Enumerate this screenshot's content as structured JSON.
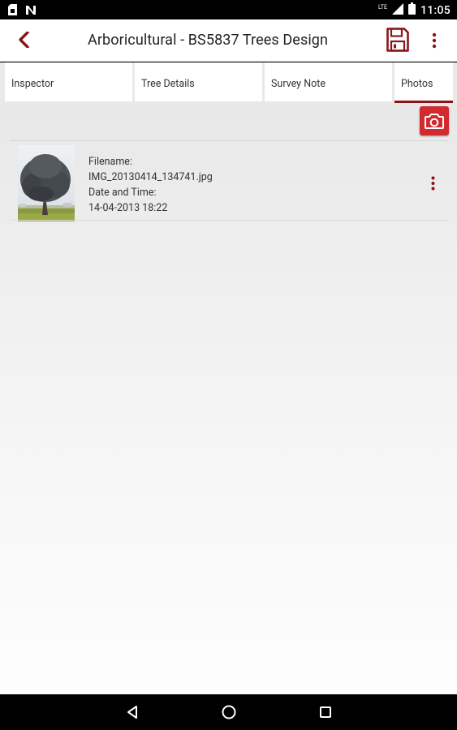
{
  "status_bar": {
    "time": "11:05",
    "network_label": "LTE",
    "icons": [
      "sim-card-icon",
      "nfc-icon",
      "signal-icon",
      "battery-icon"
    ]
  },
  "app_bar": {
    "title": "Arboricultural - BS5837 Trees Design",
    "back_icon": "chevron-left-icon",
    "save_icon": "floppy-disk-icon",
    "menu_icon": "more-vert-icon"
  },
  "tabs": [
    {
      "label": "Inspector",
      "active": false
    },
    {
      "label": "Tree Details",
      "active": false
    },
    {
      "label": "Survey Note",
      "active": false
    },
    {
      "label": "Photos",
      "active": true
    }
  ],
  "toolbar": {
    "camera_icon": "camera-icon"
  },
  "photos": [
    {
      "filename_label": "Filename:",
      "filename": "IMG_20130414_134741.jpg",
      "datetime_label": "Date and Time:",
      "datetime": "14-04-2013 18:22",
      "menu_icon": "more-vert-icon"
    }
  ],
  "nav_bar": {
    "icons": [
      "back-triangle-icon",
      "home-circle-icon",
      "recents-square-icon"
    ]
  },
  "colors": {
    "accent": "#8b1419",
    "camera_button": "#d12a2f"
  }
}
